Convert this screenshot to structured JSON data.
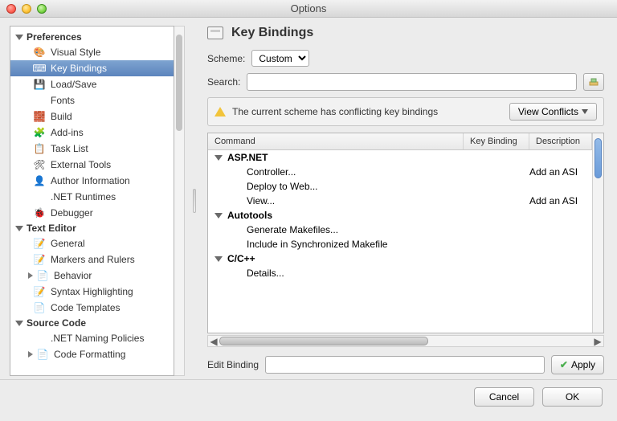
{
  "window": {
    "title": "Options"
  },
  "sidebar": {
    "categories": [
      {
        "label": "Preferences",
        "expanded": true,
        "items": [
          {
            "label": "Visual Style",
            "icon": "🎨"
          },
          {
            "label": "Key Bindings",
            "icon": "⌨",
            "selected": true
          },
          {
            "label": "Load/Save",
            "icon": "💾"
          },
          {
            "label": "Fonts",
            "icon": ""
          },
          {
            "label": "Build",
            "icon": "🧱"
          },
          {
            "label": "Add-ins",
            "icon": "🧩"
          },
          {
            "label": "Task List",
            "icon": "📋"
          },
          {
            "label": "External Tools",
            "icon": "🛠"
          },
          {
            "label": "Author Information",
            "icon": "👤"
          },
          {
            "label": ".NET Runtimes",
            "icon": ""
          },
          {
            "label": "Debugger",
            "icon": "🐞"
          }
        ]
      },
      {
        "label": "Text Editor",
        "expanded": true,
        "items": [
          {
            "label": "General",
            "icon": "📝"
          },
          {
            "label": "Markers and Rulers",
            "icon": "📝"
          },
          {
            "label": "Behavior",
            "icon": "📄",
            "hasChildren": true
          },
          {
            "label": "Syntax Highlighting",
            "icon": "📝"
          },
          {
            "label": "Code Templates",
            "icon": "📄"
          }
        ]
      },
      {
        "label": "Source Code",
        "expanded": true,
        "items": [
          {
            "label": ".NET Naming Policies",
            "icon": ""
          },
          {
            "label": "Code Formatting",
            "icon": "📄",
            "hasChildren": true
          }
        ]
      }
    ]
  },
  "main": {
    "title": "Key Bindings",
    "scheme_label": "Scheme:",
    "scheme_value": "Custom",
    "search_label": "Search:",
    "search_value": "",
    "warning_text": "The current scheme has conflicting key bindings",
    "view_conflicts": "View Conflicts",
    "columns": {
      "command": "Command",
      "binding": "Key Binding",
      "description": "Description"
    },
    "groups": [
      {
        "name": "ASP.NET",
        "rows": [
          {
            "cmd": "Controller...",
            "binding": "",
            "desc": "Add an ASI"
          },
          {
            "cmd": "Deploy to Web...",
            "binding": "",
            "desc": ""
          },
          {
            "cmd": "View...",
            "binding": "",
            "desc": "Add an ASI"
          }
        ]
      },
      {
        "name": "Autotools",
        "rows": [
          {
            "cmd": "Generate Makefiles...",
            "binding": "",
            "desc": ""
          },
          {
            "cmd": "Include in Synchronized Makefile",
            "binding": "",
            "desc": ""
          }
        ]
      },
      {
        "name": "C/C++",
        "rows": [
          {
            "cmd": "Details...",
            "binding": "",
            "desc": ""
          }
        ]
      }
    ],
    "edit_label": "Edit Binding",
    "edit_value": "",
    "apply": "Apply"
  },
  "footer": {
    "cancel": "Cancel",
    "ok": "OK"
  }
}
